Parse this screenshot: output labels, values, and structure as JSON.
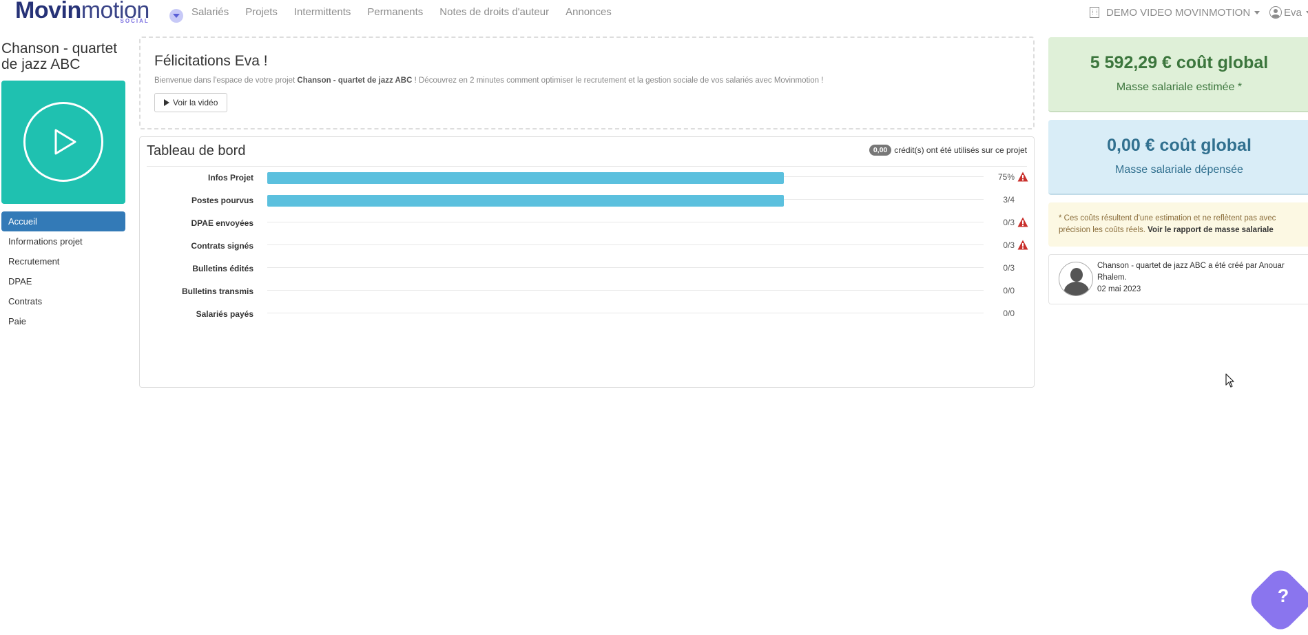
{
  "logo": {
    "word_bold": "Movin",
    "word_light": "motion",
    "sub": "SOCIAL"
  },
  "nav": {
    "links": [
      "Salariés",
      "Projets",
      "Intermittents",
      "Permanents",
      "Notes de droits d'auteur",
      "Annonces"
    ],
    "org_name": "DEMO VIDEO MOVINMOTION",
    "user": "Eva"
  },
  "project": {
    "title": "Chanson - quartet de jazz ABC",
    "menu": [
      "Accueil",
      "Informations projet",
      "Recrutement",
      "DPAE",
      "Contrats",
      "Paie"
    ],
    "active_index": 0
  },
  "welcome": {
    "title": "Félicitations Eva !",
    "text_before": "Bienvenue dans l'espace de votre projet ",
    "text_project": "Chanson - quartet de jazz ABC",
    "text_after": " ! Découvrez en 2 minutes comment optimiser le recrutement et la gestion sociale de vos salariés avec Movinmotion !",
    "button": "Voir la vidéo"
  },
  "dashboard": {
    "title": "Tableau de bord",
    "credits_badge": "0,00",
    "credits_text": "crédit(s) ont été utilisés sur ce projet",
    "rows": [
      {
        "label": "Infos Projet",
        "value": "75%",
        "progress": 0.75,
        "warning": true
      },
      {
        "label": "Postes pourvus",
        "value": "3/4",
        "progress": 0.75,
        "warning": false
      },
      {
        "label": "DPAE envoyées",
        "value": "0/3",
        "progress": 0,
        "warning": true
      },
      {
        "label": "Contrats signés",
        "value": "0/3",
        "progress": 0,
        "warning": true
      },
      {
        "label": "Bulletins édités",
        "value": "0/3",
        "progress": 0,
        "warning": false
      },
      {
        "label": "Bulletins transmis",
        "value": "0/0",
        "progress": 0,
        "warning": false
      },
      {
        "label": "Salariés payés",
        "value": "0/0",
        "progress": 0,
        "warning": false
      }
    ]
  },
  "costs": {
    "estimated_amount": "5 592,29 € coût global",
    "estimated_label": "Masse salariale estimée *",
    "spent_amount": "0,00 € coût global",
    "spent_label": "Masse salariale dépensée",
    "note_text": "* Ces coûts résultent d'une estimation et ne reflètent pas avec précision les coûts réels. ",
    "note_link": "Voir le rapport de masse salariale"
  },
  "activity": {
    "text": "Chanson - quartet de jazz ABC a été créé par Anouar Rhalem.",
    "date": "02 mai 2023"
  },
  "help": {
    "label": "?"
  },
  "colors": {
    "accent": "#337ab7",
    "teal": "#1fc1b0",
    "bar": "#5bc0de",
    "warning": "#c9302c",
    "help": "#8a75ee"
  }
}
